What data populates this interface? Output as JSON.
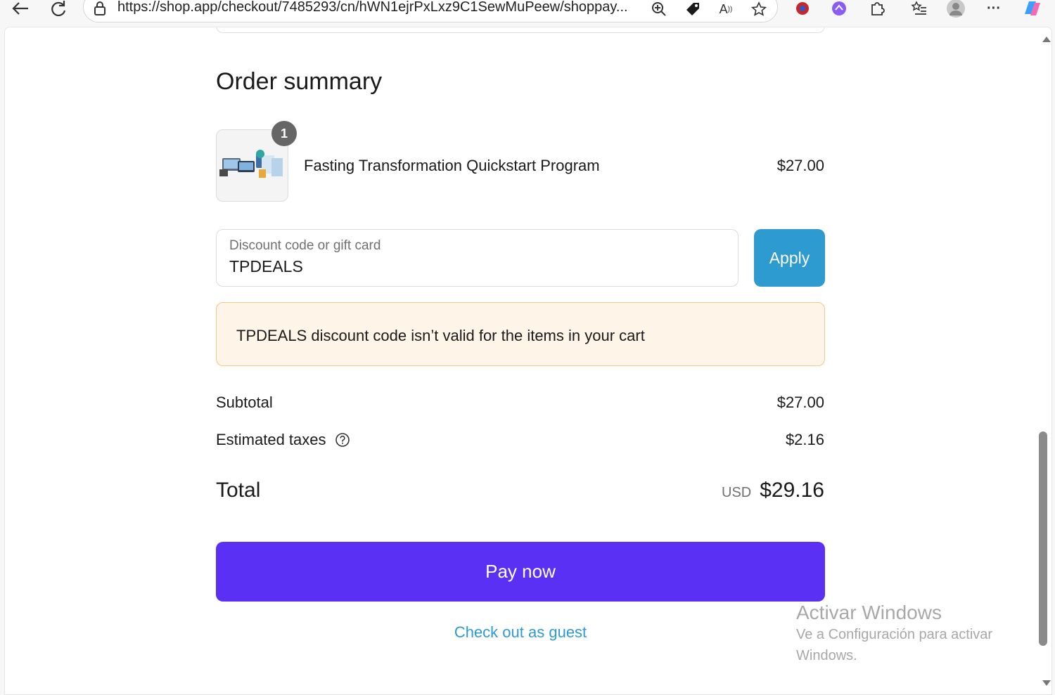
{
  "browser": {
    "url": "https://shop.app/checkout/7485293/cn/hWN1ejrPxLxz9C1SewMuPeew/shoppay..."
  },
  "order_summary": {
    "title": "Order summary",
    "item": {
      "quantity": "1",
      "name": "Fasting Transformation Quickstart Program",
      "price": "$27.00"
    },
    "discount": {
      "label": "Discount code or gift card",
      "value": "TPDEALS",
      "apply_label": "Apply"
    },
    "alert": {
      "message": "TPDEALS discount code isn’t valid for the items in your cart"
    },
    "subtotal": {
      "label": "Subtotal",
      "value": "$27.00"
    },
    "taxes": {
      "label": "Estimated taxes",
      "value": "$2.16"
    },
    "total": {
      "label": "Total",
      "currency": "USD",
      "value": "$29.16"
    },
    "pay_label": "Pay now",
    "guest_label": "Check out as guest"
  },
  "watermark": {
    "title": "Activar Windows",
    "subtitle": "Ve a Configuración para activar Windows."
  },
  "colors": {
    "pay_button": "#5a31f4",
    "apply_button": "#2e9bd0",
    "alert_bg": "#fff4e8",
    "link": "#2e9bd0"
  }
}
